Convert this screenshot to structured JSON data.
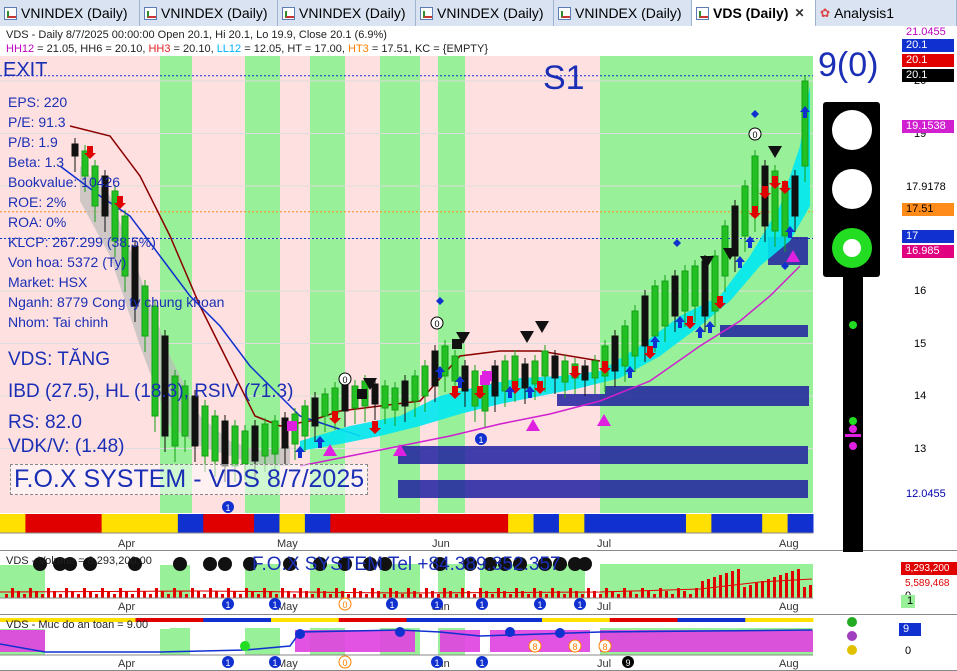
{
  "tabs": [
    {
      "label": "VNINDEX (Daily)",
      "active": false
    },
    {
      "label": "VNINDEX (Daily)",
      "active": false
    },
    {
      "label": "VNINDEX (Daily)",
      "active": false
    },
    {
      "label": "VNINDEX (Daily)",
      "active": false
    },
    {
      "label": "VNINDEX (Daily)",
      "active": false
    },
    {
      "label": "VDS (Daily)",
      "active": true,
      "close": "✕"
    },
    {
      "label": "Analysis1",
      "active": false
    }
  ],
  "header": {
    "line1": "VDS - Daily 8/7/2025 00:00:00 Open 20.1, Hi 20.1, Lo 19.9, Close 20.1 (6.9%)",
    "line2_parts": [
      {
        "text": "HH12",
        "color": "#c000c0"
      },
      {
        "text": " = 21.05, HH6 = 20.10, ",
        "color": "#222"
      },
      {
        "text": "HH3",
        "color": "#e02020"
      },
      {
        "text": " = 20.10, ",
        "color": "#222"
      },
      {
        "text": "LL12",
        "color": "#00b0ff"
      },
      {
        "text": " = 12.05, HT = 17.00, ",
        "color": "#222"
      },
      {
        "text": "HT3",
        "color": "#ff7f00"
      },
      {
        "text": " = 17.51, KC = {EMPTY}",
        "color": "#222"
      }
    ]
  },
  "stats": {
    "exit": "EXIT",
    "eps": "EPS: 220",
    "pe": "P/E: 91.3",
    "pb": "P/B: 1.9",
    "beta": "Beta: 1.3",
    "bookvalue": "Bookvalue: 10426",
    "roe": "ROE: 2%",
    "roa": "ROA: 0%",
    "klcp": "KLCP: 267.299 (38.5%)",
    "vonhoa": "Von hoa: 5372 (Ty)",
    "market": "Market: HSX",
    "nganh": "Nganh: 8779 Cong ty chung khoan",
    "nhom": "Nhom: Tai chinh",
    "trend": "VDS: TĂNG",
    "ibd": "IBD (27.5), HL (18.3), RSIV (71.3)",
    "rs": "RS: 82.0",
    "vdk": "VDK/V:  (1.48)",
    "system_title": "F.O.X SYSTEM - VDS 8/7/2025"
  },
  "signal": {
    "s1": "S1",
    "count": "9(0)"
  },
  "price_axis": {
    "ticks": [
      "20",
      "19",
      "18",
      "17",
      "16",
      "15",
      "14",
      "13"
    ],
    "tags": [
      {
        "text": "21.0455",
        "bg": "#ffffff",
        "fg": "#c000c0"
      },
      {
        "text": "20.1",
        "bg": "#1030d0",
        "fg": "#ffffff"
      },
      {
        "text": "20.1",
        "bg": "#e00000",
        "fg": "#ffffff"
      },
      {
        "text": "20.1",
        "bg": "#000000",
        "fg": "#ffffff"
      },
      {
        "text": "19.1538",
        "bg": "#d020d0",
        "fg": "#ffffff"
      },
      {
        "text": "17.9178",
        "bg": "#ffffff",
        "fg": "#000000"
      },
      {
        "text": "17.51",
        "bg": "#ff8c1a",
        "fg": "#000000"
      },
      {
        "text": "17",
        "bg": "#1030d0",
        "fg": "#ffffff"
      },
      {
        "text": "16.985",
        "bg": "#e00080",
        "fg": "#ffffff"
      },
      {
        "text": "12.0455",
        "bg": "#ffffff",
        "fg": "#0000aa"
      }
    ]
  },
  "months": [
    "Apr",
    "May",
    "Jun",
    "Jul",
    "Aug"
  ],
  "volume": {
    "title": "VDS - Volume = 8,293,200.00",
    "banner": "F.O.X SYSTEM Tel +84.389.352.357",
    "axis_tags": [
      {
        "text": "8,293,200",
        "bg": "#e00000",
        "fg": "#ffffff"
      },
      {
        "text": "5,589,468",
        "bg": "#ffffff",
        "fg": "#e00000"
      }
    ],
    "ticks": [
      "0"
    ],
    "marker": "1"
  },
  "safety": {
    "title": "VDS - Muc do an toan = 9.00",
    "axis_tag": "9",
    "ticks": [
      "0"
    ]
  },
  "markers": {
    "one": "1",
    "zero": "0",
    "eight": "8",
    "nine": "9"
  },
  "colors": {
    "green_zone": "#98f098",
    "red_zone": "#ffe0e0",
    "accent_blue": "#1a2fb5",
    "cyan_band": "#00e8f0",
    "navy_zone": "#2020a0"
  }
}
